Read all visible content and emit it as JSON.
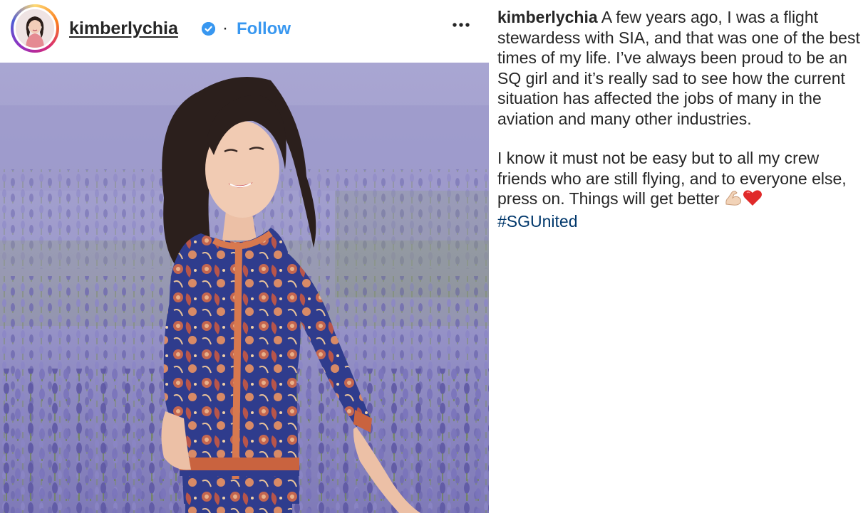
{
  "post": {
    "username": "kimberlychia",
    "separator": "·",
    "follow_label": "Follow",
    "more_label": "•••",
    "icons": {
      "verified": "verified-badge-icon",
      "more": "more-options-icon",
      "flex": "flexed-biceps-icon",
      "heart": "red-heart-icon"
    },
    "colors": {
      "follow": "#3897f0",
      "verified": "#3897f0",
      "hashtag": "#00376b",
      "text": "#262626"
    }
  },
  "caption": {
    "author": "kimberlychia",
    "paragraph1": "A few years ago, I was a flight stewardess with SIA, and that was one of the best times of my life. I’ve always been proud to be an SQ girl and it’s really sad to see how the current situation has affected the jobs of many in the aviation and many other industries.",
    "paragraph2": "I know it must not be easy but to all my crew friends who are still flying, and to everyone else, press on. Things will get better",
    "hashtag": "#SGUnited"
  }
}
